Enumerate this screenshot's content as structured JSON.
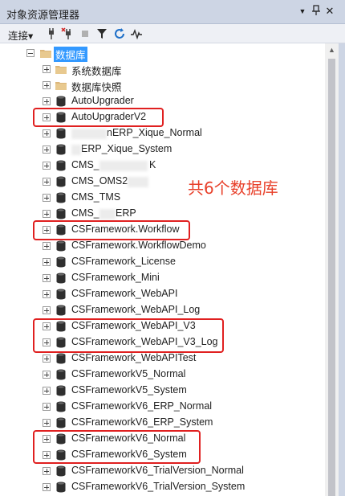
{
  "window": {
    "title": "对象资源管理器",
    "pin_glyph": "▼",
    "dock_glyph": "ㅁ",
    "close_glyph": "✕"
  },
  "toolbar": {
    "connect_label": "连接",
    "connect_caret": "▾"
  },
  "tree": {
    "root": {
      "label": "数据库"
    },
    "items": [
      {
        "label": "系统数据库",
        "type": "folder"
      },
      {
        "label": "数据库快照",
        "type": "folder"
      },
      {
        "label": "AutoUpgrader",
        "type": "database"
      },
      {
        "label": "AutoUpgraderV2",
        "type": "database"
      },
      {
        "label": "nERP_Xique_Normal",
        "type": "database"
      },
      {
        "label": "ERP_Xique_System",
        "type": "database"
      },
      {
        "label": "CMS_",
        "suffix": "K",
        "type": "database"
      },
      {
        "label": "CMS_OMS2",
        "type": "database"
      },
      {
        "label": "CMS_TMS",
        "type": "database"
      },
      {
        "label": "CMS_",
        "suffix": "ERP",
        "type": "database"
      },
      {
        "label": "CSFramework.Workflow",
        "type": "database"
      },
      {
        "label": "CSFramework.WorkflowDemo",
        "type": "database"
      },
      {
        "label": "CSFramework_License",
        "type": "database"
      },
      {
        "label": "CSFramework_Mini",
        "type": "database"
      },
      {
        "label": "CSFramework_WebAPI",
        "type": "database"
      },
      {
        "label": "CSFramework_WebAPI_Log",
        "type": "database"
      },
      {
        "label": "CSFramework_WebAPI_V3",
        "type": "database"
      },
      {
        "label": "CSFramework_WebAPI_V3_Log",
        "type": "database"
      },
      {
        "label": "CSFramework_WebAPITest",
        "type": "database"
      },
      {
        "label": "CSFrameworkV5_Normal",
        "type": "database"
      },
      {
        "label": "CSFrameworkV5_System",
        "type": "database"
      },
      {
        "label": "CSFrameworkV6_ERP_Normal",
        "type": "database"
      },
      {
        "label": "CSFrameworkV6_ERP_System",
        "type": "database"
      },
      {
        "label": "CSFrameworkV6_Normal",
        "type": "database"
      },
      {
        "label": "CSFrameworkV6_System",
        "type": "database"
      },
      {
        "label": "CSFrameworkV6_TrialVersion_Normal",
        "type": "database"
      },
      {
        "label": "CSFrameworkV6_TrialVersion_System",
        "type": "database"
      }
    ]
  },
  "annotation": {
    "text": "共6个数据库",
    "color": "#e8402a"
  },
  "colors": {
    "selection": "#3399ff",
    "highlight_box": "#e02020",
    "title_bar": "#cdd5e4"
  }
}
